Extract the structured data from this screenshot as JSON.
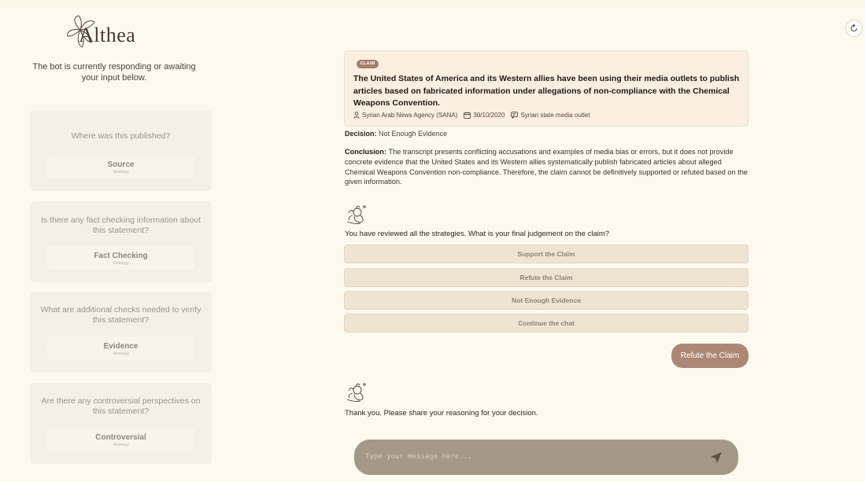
{
  "app": {
    "logo_text": "Althea"
  },
  "sidebar": {
    "status": "The bot is currently responding or awaiting your input below.",
    "strategies": [
      {
        "question": "Where was this published?",
        "title": "Source",
        "subtitle": "Strategy"
      },
      {
        "question": "Is there any fact checking information about this statement?",
        "title": "Fact Checking",
        "subtitle": "Strategy"
      },
      {
        "question": "What are additional checks needed to verify this statement?",
        "title": "Evidence",
        "subtitle": "Strategy"
      },
      {
        "question": "Are there any controversial perspectives on this statement?",
        "title": "Controversial",
        "subtitle": "Strategy"
      }
    ]
  },
  "header": {
    "refresh_icon": "refresh-icon"
  },
  "claim": {
    "badge": "CLAIM",
    "text": "The United States of America and its Western allies have been using their media outlets to publish articles based on fabricated information under allegations of non-compliance with the Chemical Weapons Convention.",
    "source": "Syrian Arab News Agency (SANA)",
    "date": "30/10/2020",
    "outlet": "Syrian state media outlet"
  },
  "chat": {
    "decision_label": "Decision:",
    "decision_value": "Not Enough Evidence",
    "conclusion_label": "Conclusion:",
    "conclusion_text": "The transcript presents conflicting accusations and examples of media bias or errors, but it does not provide concrete evidence that the United States and its Western allies systematically publish fabricated articles about alleged Chemical Weapons Convention non-compliance. Therefore, the claim cannot be definitively supported or refuted based on the given information.",
    "prompt": "You have reviewed all the strategies. What is your final judgement on the claim?",
    "options": [
      "Support the Claim",
      "Refute the Claim",
      "Not Enough Evidence",
      "Continue the chat"
    ],
    "user_reply": "Refute the Claim",
    "followup": "Thank you. Please share your reasoning for your decision."
  },
  "composer": {
    "placeholder": "Type your message here..."
  },
  "colors": {
    "accent": "#ad8776",
    "background": "#fdf9ee",
    "card": "#f5f0e4"
  }
}
